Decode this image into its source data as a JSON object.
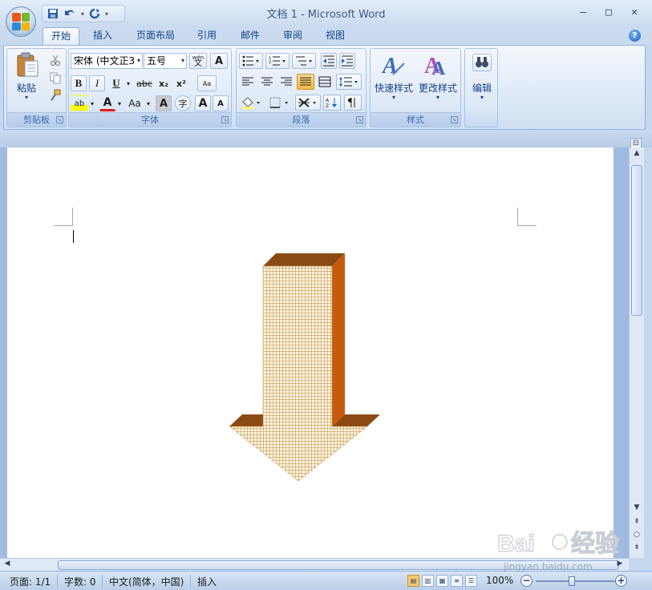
{
  "window": {
    "title": "文档 1 - Microsoft Word",
    "controls": {
      "minimize": "–",
      "maximize": "□",
      "close": "✕"
    }
  },
  "quick_access": {
    "save_icon": "save-icon",
    "undo_icon": "undo-icon",
    "redo_icon": "redo-icon",
    "customize_icon": "customize-qat-icon"
  },
  "tabs": [
    "开始",
    "插入",
    "页面布局",
    "引用",
    "邮件",
    "审阅",
    "视图"
  ],
  "active_tab": "开始",
  "help_label": "?",
  "ribbon": {
    "clipboard": {
      "label": "剪贴板",
      "paste": "粘贴",
      "paste_arrow": "▾"
    },
    "font": {
      "label": "字体",
      "font_name": "宋体 (中文正3",
      "font_size": "五号",
      "bold": "B",
      "italic": "I",
      "underline": "U",
      "strike": "abc",
      "subscript": "x₂",
      "superscript": "x²",
      "font_color_letter": "A",
      "change_case": "Aa",
      "char_shading": "A",
      "enclose": "字",
      "grow": "A",
      "shrink": "A",
      "phonetic": "wén",
      "phonetic_char": "文",
      "char_border": "A",
      "highlight": "ab",
      "clear": "Aa"
    },
    "paragraph": {
      "label": "段落"
    },
    "styles": {
      "label": "样式",
      "quick_styles": "快速样式",
      "change_styles": "更改样式",
      "arrow": "▾"
    },
    "editing": {
      "label": "编辑",
      "arrow": "▾"
    }
  },
  "status": {
    "page": "页面: 1/1",
    "words": "字数: 0",
    "language": "中文(简体，中国)",
    "mode": "插入",
    "zoom": "100%",
    "zoom_minus": "−",
    "zoom_plus": "+"
  },
  "colors": {
    "arrow_front": "#d2a45a",
    "arrow_top": "#8b4a14",
    "arrow_side": "#c85a10",
    "accent": "#15428b"
  },
  "watermark": {
    "text": "jingyan.baidu.com"
  }
}
